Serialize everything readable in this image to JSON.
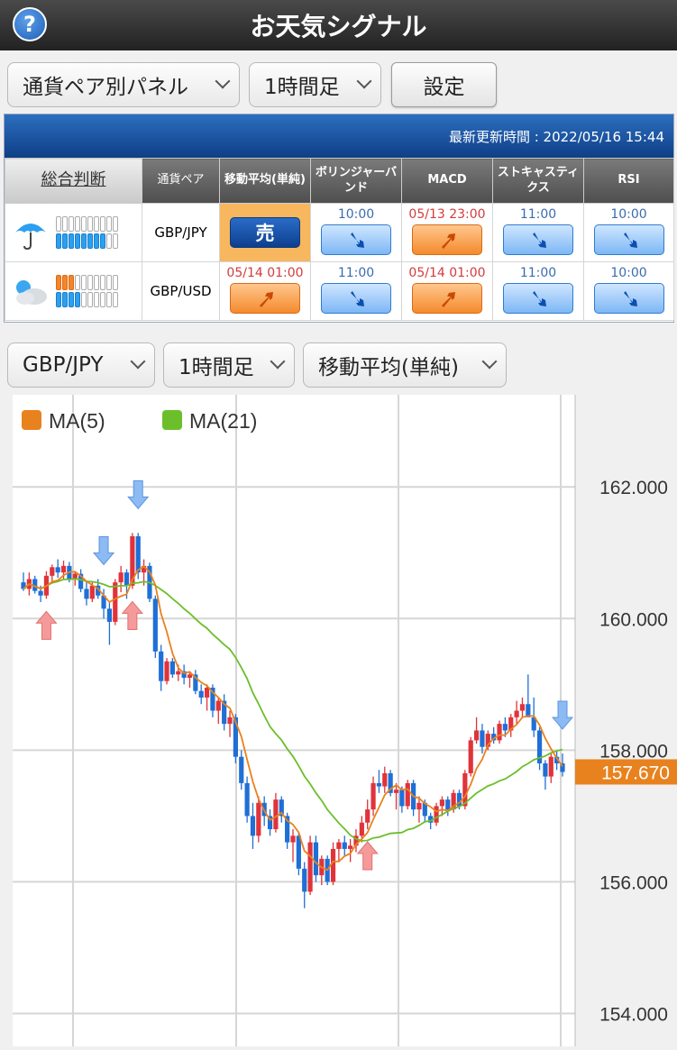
{
  "header": {
    "title": "お天気シグナル",
    "help": "?"
  },
  "controls": {
    "panel_select": "通貨ペア別パネル",
    "timeframe_select": "1時間足",
    "settings_button": "設定"
  },
  "panel": {
    "update_label": "最新更新時間 : 2022/05/16 15:44",
    "columns": {
      "overall": "総合判断",
      "pair": "通貨ペア",
      "ma": "移動平均(単純)",
      "bb": "ボリンジャーバンド",
      "macd": "MACD",
      "stoch": "ストキャスティクス",
      "rsi": "RSI"
    },
    "rows": [
      {
        "pair": "GBP/JPY",
        "weather": "umbrella-rain",
        "orange": 0,
        "blue": 8,
        "ma": {
          "text": "売",
          "kind": "sell"
        },
        "bb": {
          "time": "10:00",
          "color": "blue",
          "dir": "down"
        },
        "macd": {
          "time": "05/13 23:00",
          "color": "red",
          "dir": "up"
        },
        "stoch": {
          "time": "11:00",
          "color": "blue",
          "dir": "down"
        },
        "rsi": {
          "time": "10:00",
          "color": "blue",
          "dir": "down"
        }
      },
      {
        "pair": "GBP/USD",
        "weather": "cloudy",
        "orange": 3,
        "blue": 4,
        "ma": {
          "time": "05/14 01:00",
          "color": "red",
          "dir": "up"
        },
        "bb": {
          "time": "11:00",
          "color": "blue",
          "dir": "down"
        },
        "macd": {
          "time": "05/14 01:00",
          "color": "red",
          "dir": "up"
        },
        "stoch": {
          "time": "11:00",
          "color": "blue",
          "dir": "down"
        },
        "rsi": {
          "time": "10:00",
          "color": "blue",
          "dir": "down"
        }
      }
    ]
  },
  "chart_controls": {
    "pair_select": "GBP/JPY",
    "timeframe_select": "1時間足",
    "indicator_select": "移動平均(単純)"
  },
  "chart_data": {
    "type": "candlestick",
    "legend": [
      {
        "name": "MA(5)",
        "color": "#e8821e"
      },
      {
        "name": "MA(21)",
        "color": "#6cbf2a"
      }
    ],
    "y_ticks": [
      162.0,
      160.0,
      158.0,
      156.0,
      154.0
    ],
    "y_tick_labels": [
      "162.000",
      "160.000",
      "158.000",
      "156.000",
      "154.000"
    ],
    "ylim": [
      153.5,
      163.4
    ],
    "current_price": "157.670",
    "current_value": 157.67,
    "up_color": "#e0333a",
    "down_color": "#1f6fd6",
    "sell_arrow_candles": [
      14,
      20,
      94
    ],
    "buy_arrow_candles": [
      4,
      19,
      60
    ],
    "candles": [
      [
        160.55,
        160.7,
        160.42,
        160.45
      ],
      [
        160.45,
        160.7,
        160.35,
        160.6
      ],
      [
        160.6,
        160.65,
        160.38,
        160.42
      ],
      [
        160.42,
        160.5,
        160.25,
        160.35
      ],
      [
        160.35,
        160.72,
        160.3,
        160.65
      ],
      [
        160.65,
        160.82,
        160.55,
        160.78
      ],
      [
        160.78,
        160.9,
        160.62,
        160.7
      ],
      [
        160.7,
        160.88,
        160.6,
        160.8
      ],
      [
        160.8,
        160.86,
        160.55,
        160.6
      ],
      [
        160.6,
        160.72,
        160.5,
        160.68
      ],
      [
        160.68,
        160.75,
        160.4,
        160.45
      ],
      [
        160.45,
        160.58,
        160.2,
        160.3
      ],
      [
        160.3,
        160.55,
        160.25,
        160.5
      ],
      [
        160.5,
        160.6,
        160.3,
        160.35
      ],
      [
        160.35,
        160.45,
        160.0,
        160.15
      ],
      [
        160.15,
        160.25,
        159.6,
        159.95
      ],
      [
        159.95,
        160.6,
        159.9,
        160.55
      ],
      [
        160.55,
        160.8,
        160.4,
        160.7
      ],
      [
        160.7,
        160.75,
        160.3,
        160.5
      ],
      [
        160.5,
        161.3,
        160.45,
        161.25
      ],
      [
        161.25,
        161.3,
        160.6,
        160.7
      ],
      [
        160.7,
        160.9,
        160.5,
        160.8
      ],
      [
        160.8,
        160.85,
        160.25,
        160.3
      ],
      [
        160.3,
        160.35,
        159.4,
        159.5
      ],
      [
        159.5,
        159.6,
        158.9,
        159.05
      ],
      [
        159.05,
        159.4,
        159.0,
        159.35
      ],
      [
        159.35,
        159.4,
        159.1,
        159.15
      ],
      [
        159.15,
        159.3,
        159.05,
        159.2
      ],
      [
        159.2,
        159.3,
        159.0,
        159.1
      ],
      [
        159.1,
        159.2,
        158.95,
        159.15
      ],
      [
        159.15,
        159.22,
        158.85,
        158.9
      ],
      [
        158.9,
        159.0,
        158.7,
        158.8
      ],
      [
        158.8,
        159.0,
        158.6,
        158.95
      ],
      [
        158.95,
        159.0,
        158.5,
        158.6
      ],
      [
        158.6,
        158.8,
        158.4,
        158.75
      ],
      [
        158.75,
        158.85,
        158.3,
        158.4
      ],
      [
        158.4,
        158.6,
        158.2,
        158.5
      ],
      [
        158.5,
        158.55,
        157.8,
        157.9
      ],
      [
        157.9,
        158.0,
        157.4,
        157.5
      ],
      [
        157.5,
        157.6,
        156.9,
        157.0
      ],
      [
        157.0,
        157.2,
        156.5,
        156.7
      ],
      [
        156.7,
        157.3,
        156.6,
        157.2
      ],
      [
        157.2,
        157.3,
        156.85,
        157.0
      ],
      [
        157.0,
        157.1,
        156.7,
        156.8
      ],
      [
        156.8,
        157.35,
        156.75,
        157.25
      ],
      [
        157.25,
        157.3,
        156.9,
        157.0
      ],
      [
        157.0,
        157.05,
        156.5,
        156.6
      ],
      [
        156.6,
        156.8,
        156.3,
        156.7
      ],
      [
        156.7,
        156.75,
        156.1,
        156.2
      ],
      [
        156.2,
        156.3,
        155.6,
        155.85
      ],
      [
        155.85,
        156.7,
        155.8,
        156.6
      ],
      [
        156.6,
        156.7,
        156.0,
        156.1
      ],
      [
        156.1,
        156.4,
        155.95,
        156.35
      ],
      [
        156.35,
        156.4,
        155.95,
        156.0
      ],
      [
        156.0,
        156.6,
        155.95,
        156.5
      ],
      [
        156.5,
        156.65,
        156.3,
        156.6
      ],
      [
        156.6,
        156.7,
        156.4,
        156.5
      ],
      [
        156.5,
        156.65,
        156.3,
        156.55
      ],
      [
        156.55,
        156.8,
        156.45,
        156.7
      ],
      [
        156.7,
        157.0,
        156.6,
        156.9
      ],
      [
        156.9,
        157.25,
        156.8,
        157.1
      ],
      [
        157.1,
        157.6,
        157.0,
        157.5
      ],
      [
        157.5,
        157.7,
        157.35,
        157.45
      ],
      [
        157.45,
        157.75,
        157.35,
        157.65
      ],
      [
        157.65,
        157.7,
        157.3,
        157.35
      ],
      [
        157.35,
        157.5,
        157.1,
        157.4
      ],
      [
        157.4,
        157.45,
        157.05,
        157.15
      ],
      [
        157.15,
        157.55,
        157.1,
        157.5
      ],
      [
        157.5,
        157.55,
        157.0,
        157.1
      ],
      [
        157.1,
        157.3,
        156.9,
        157.2
      ],
      [
        157.2,
        157.25,
        156.9,
        157.0
      ],
      [
        157.0,
        157.05,
        156.8,
        156.9
      ],
      [
        156.9,
        157.2,
        156.85,
        157.15
      ],
      [
        157.15,
        157.3,
        157.0,
        157.25
      ],
      [
        157.25,
        157.3,
        157.0,
        157.1
      ],
      [
        157.1,
        157.4,
        157.05,
        157.35
      ],
      [
        157.35,
        157.4,
        157.1,
        157.15
      ],
      [
        157.15,
        157.7,
        157.1,
        157.65
      ],
      [
        157.65,
        158.2,
        157.6,
        158.15
      ],
      [
        158.15,
        158.5,
        158.1,
        158.3
      ],
      [
        158.3,
        158.4,
        157.95,
        158.05
      ],
      [
        158.05,
        158.3,
        158.0,
        158.25
      ],
      [
        158.25,
        158.35,
        158.1,
        158.15
      ],
      [
        158.15,
        158.45,
        158.1,
        158.4
      ],
      [
        158.4,
        158.5,
        158.2,
        158.3
      ],
      [
        158.3,
        158.55,
        158.2,
        158.5
      ],
      [
        158.5,
        158.75,
        158.4,
        158.6
      ],
      [
        158.6,
        158.8,
        158.5,
        158.7
      ],
      [
        158.7,
        159.15,
        158.6,
        158.5
      ],
      [
        158.5,
        158.8,
        158.2,
        158.3
      ],
      [
        158.3,
        158.35,
        157.7,
        157.8
      ],
      [
        157.8,
        157.85,
        157.4,
        157.6
      ],
      [
        157.6,
        157.95,
        157.5,
        157.9
      ],
      [
        157.9,
        158.0,
        157.7,
        157.8
      ],
      [
        157.8,
        157.95,
        157.6,
        157.67
      ]
    ]
  }
}
